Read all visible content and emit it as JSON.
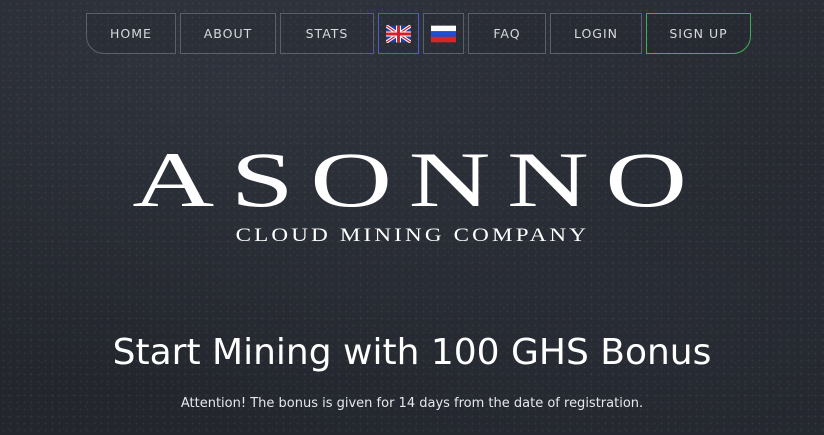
{
  "nav": {
    "home": "HOME",
    "about": "ABOUT",
    "stats": "STATS",
    "lang_en_icon": "uk-flag-icon",
    "lang_ru_icon": "russia-flag-icon",
    "faq": "FAQ",
    "login": "LOGIN",
    "signup": "SIGN UP"
  },
  "logo": {
    "title": "ASONNO",
    "subtitle": "CLOUD MINING COMPANY"
  },
  "hero": {
    "headline": "Start Mining with 100 GHS Bonus",
    "notice": "Attention! The bonus is given for 14 days from the date of registration."
  },
  "colors": {
    "background": "#25282f",
    "nav_border": "#5a606b",
    "signup_border": "#3fae58",
    "active_flag_border": "#4a5fc7",
    "text": "#ffffff"
  }
}
